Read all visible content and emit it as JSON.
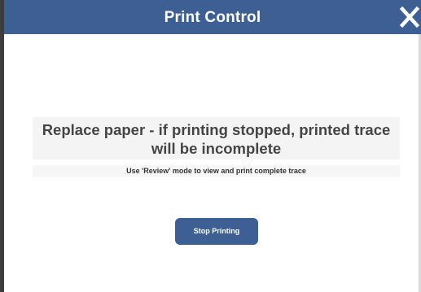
{
  "dialog": {
    "title": "Print Control",
    "close_icon": "close-icon",
    "message": "Replace paper - if printing stopped, printed trace will be incomplete",
    "hint": "Use 'Review' mode to view and print complete trace",
    "stop_button_label": "Stop Printing"
  },
  "colors": {
    "titlebar": "#3d5f94",
    "button": "#3d5f94",
    "message_text": "#454545"
  }
}
